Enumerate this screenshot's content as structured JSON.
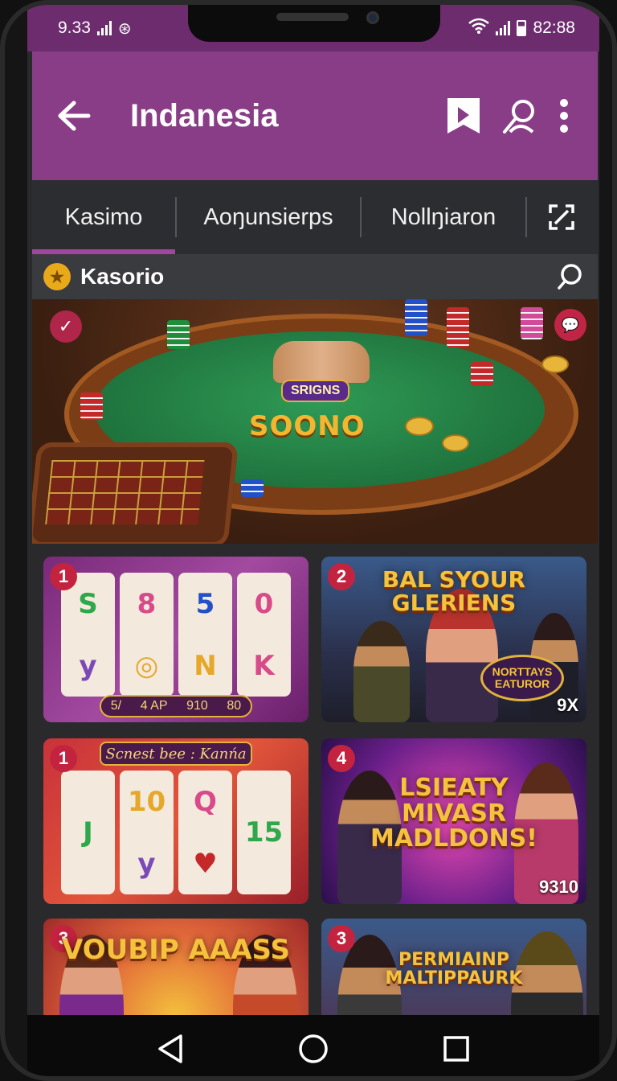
{
  "status_bar": {
    "time_left": "9.33",
    "time_right": "82:88"
  },
  "app_bar": {
    "title": "Indanesia",
    "icons": [
      "back-arrow-icon",
      "bookmark-icon",
      "account-search-icon",
      "more-vert-icon"
    ]
  },
  "tabs": [
    {
      "label": "Kasimo",
      "active": true
    },
    {
      "label": "Aoŋunsierps",
      "active": false
    },
    {
      "label": "Nollŋiaron",
      "active": false
    }
  ],
  "section": {
    "label": "Kasorio"
  },
  "hero": {
    "title": "SOONO",
    "subtitle": "SRIGNS"
  },
  "games": [
    {
      "number": "1",
      "paybar": [
        "5/",
        "4 AP",
        "910",
        "80"
      ]
    },
    {
      "number": "2",
      "headline": "BAL SYOUR GLERIENS",
      "pill": "NORTTAYS EATUROR",
      "corner": "9X"
    },
    {
      "number": "1",
      "banner": "Scnest bee : Kanńa"
    },
    {
      "number": "4",
      "headline": "LSIEATY MIVASR MADLDONS!",
      "corner": "9310"
    },
    {
      "number": "3",
      "headline": "VOUBIP AAASS"
    },
    {
      "number": "3",
      "headline": "PERMIAINP MALTIPPAURK"
    }
  ],
  "colors": {
    "app_bar": "#8a3d87",
    "status_bar": "#6d2c6e",
    "tab_indicator": "#a046a0",
    "badge": "#c4233f"
  }
}
